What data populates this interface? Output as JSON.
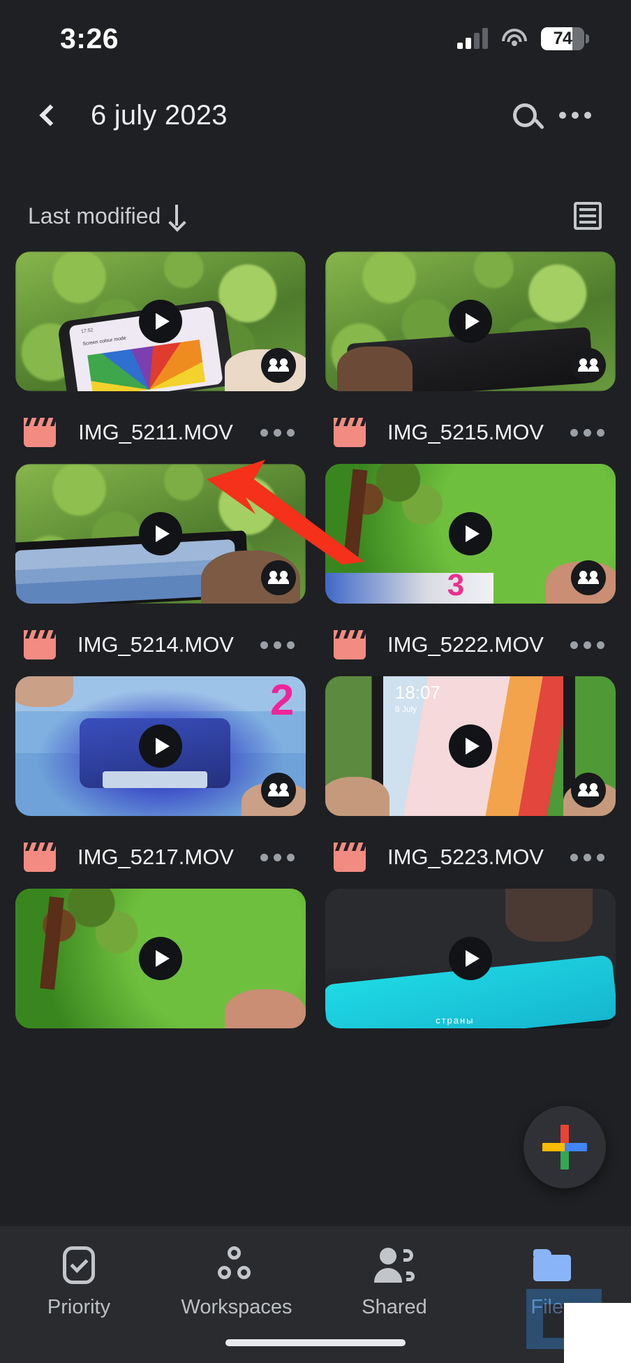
{
  "status_bar": {
    "time": "3:26",
    "battery_level": "74",
    "signal_icon": "cellular-signal-icon",
    "wifi_icon": "wifi-icon",
    "battery_icon": "battery-icon"
  },
  "app_bar": {
    "back_icon": "back-chevron-icon",
    "title": "6 july 2023",
    "search_icon": "search-icon",
    "overflow_icon": "more-options-icon"
  },
  "sort_bar": {
    "label": "Last modified",
    "direction_icon": "arrow-down-icon",
    "view_toggle_icon": "list-view-icon"
  },
  "files": [
    {
      "name": "IMG_5211.MOV",
      "type_icon": "movie-clapperboard-icon",
      "shared": true,
      "play_icon": "play-icon",
      "menu_icon": "item-more-icon",
      "scene": "sc-trees",
      "variant": "phone-rainbow"
    },
    {
      "name": "IMG_5215.MOV",
      "type_icon": "movie-clapperboard-icon",
      "shared": true,
      "play_icon": "play-icon",
      "menu_icon": "item-more-icon",
      "scene": "sc-trees",
      "variant": "phone-hand"
    },
    {
      "name": "IMG_5214.MOV",
      "type_icon": "movie-clapperboard-icon",
      "shared": true,
      "play_icon": "play-icon",
      "menu_icon": "item-more-icon",
      "scene": "sc-trees",
      "variant": "phone-city"
    },
    {
      "name": "IMG_5222.MOV",
      "type_icon": "movie-clapperboard-icon",
      "shared": true,
      "play_icon": "play-icon",
      "menu_icon": "item-more-icon",
      "scene": "sc-green",
      "variant": "bonsai"
    },
    {
      "name": "IMG_5217.MOV",
      "type_icon": "movie-clapperboard-icon",
      "shared": true,
      "play_icon": "play-icon",
      "menu_icon": "item-more-icon",
      "scene": "sc-game",
      "variant": "racing-game"
    },
    {
      "name": "IMG_5223.MOV",
      "type_icon": "movie-clapperboard-icon",
      "shared": true,
      "play_icon": "play-icon",
      "menu_icon": "item-more-icon",
      "scene": "sc-lock",
      "variant": "lockscreen"
    },
    {
      "name": "",
      "type_icon": "",
      "shared": false,
      "play_icon": "play-icon",
      "menu_icon": "",
      "scene": "sc-green",
      "variant": "bonsai"
    },
    {
      "name": "",
      "type_icon": "",
      "shared": false,
      "play_icon": "play-icon",
      "menu_icon": "",
      "scene": "sc-dark",
      "variant": "cyan-phone"
    }
  ],
  "thumbnail_overlays": {
    "lockscreen_time": "18:07",
    "lockscreen_date": "6 July",
    "game_number": "2",
    "bonsai_number": "3",
    "phone_ui_time": "17:52",
    "phone_ui_title": "Screen colour mode"
  },
  "fab": {
    "label_icon": "google-plus-create-icon",
    "colors": {
      "red": "#ea4335",
      "yellow": "#fbbc04",
      "green": "#34a853",
      "blue": "#4285f4"
    }
  },
  "bottom_nav": {
    "items": [
      {
        "label": "Priority",
        "icon": "priority-check-icon",
        "active": false
      },
      {
        "label": "Workspaces",
        "icon": "workspaces-icon",
        "active": false
      },
      {
        "label": "Shared",
        "icon": "shared-people-icon",
        "active": false
      },
      {
        "label": "Files",
        "icon": "files-folder-icon",
        "active": true
      }
    ],
    "active_color": "#8ab4f8",
    "inactive_color": "#bcc0c4"
  },
  "annotation": {
    "arrow_icon": "red-pointer-arrow",
    "color": "#f5301b",
    "points_at": "IMG_5211.MOV item-more-icon"
  },
  "theme": {
    "background": "#1f2023",
    "nav_background": "#2a2b2e",
    "file_icon_color": "#f28b82",
    "text_primary": "#f1f3f4",
    "text_secondary": "#c9ccd0"
  }
}
